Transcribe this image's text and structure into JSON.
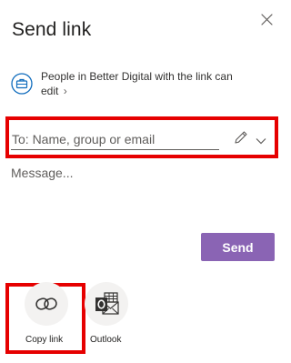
{
  "dialog": {
    "title": "Send link",
    "close_label": "Close"
  },
  "permission": {
    "text": "People in Better Digital with the link can edit",
    "chevron": "›",
    "icon": "briefcase-icon"
  },
  "recipients": {
    "placeholder": "To: Name, group or email",
    "value": ""
  },
  "message": {
    "placeholder": "Message..."
  },
  "actions": {
    "send_label": "Send"
  },
  "share_options": [
    {
      "label": "Copy link",
      "icon": "link-icon"
    },
    {
      "label": "Outlook",
      "icon": "outlook-icon"
    }
  ],
  "colors": {
    "accent": "#8a64b4",
    "highlight": "#e60000",
    "icon_blue": "#0f6cbd"
  }
}
